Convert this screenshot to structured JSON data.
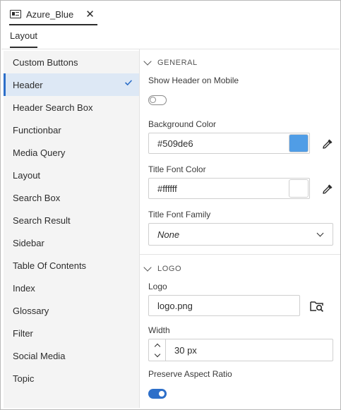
{
  "tab": {
    "title": "Azure_Blue",
    "close_glyph": "✕",
    "icon": "layout-panel-icon"
  },
  "subtab": {
    "label": "Layout"
  },
  "sidebar": {
    "items": [
      {
        "label": "Custom Buttons",
        "selected": false
      },
      {
        "label": "Header",
        "selected": true
      },
      {
        "label": "Header Search Box",
        "selected": false
      },
      {
        "label": "Functionbar",
        "selected": false
      },
      {
        "label": "Media Query",
        "selected": false
      },
      {
        "label": "Layout",
        "selected": false
      },
      {
        "label": "Search Box",
        "selected": false
      },
      {
        "label": "Search Result",
        "selected": false
      },
      {
        "label": "Sidebar",
        "selected": false
      },
      {
        "label": "Table Of Contents",
        "selected": false
      },
      {
        "label": "Index",
        "selected": false
      },
      {
        "label": "Glossary",
        "selected": false
      },
      {
        "label": "Filter",
        "selected": false
      },
      {
        "label": "Social Media",
        "selected": false
      },
      {
        "label": "Topic",
        "selected": false
      }
    ]
  },
  "general": {
    "title": "GENERAL",
    "show_header_mobile": {
      "label": "Show Header on Mobile",
      "on": false
    },
    "background_color": {
      "label": "Background Color",
      "value": "#509de6",
      "swatch": "#509de6"
    },
    "title_font_color": {
      "label": "Title Font Color",
      "value": "#ffffff",
      "swatch": "#ffffff"
    },
    "title_font_family": {
      "label": "Title Font Family",
      "value": "None"
    }
  },
  "logo": {
    "title": "LOGO",
    "logo_field": {
      "label": "Logo",
      "value": "logo.png"
    },
    "width": {
      "label": "Width",
      "value": "30 px"
    },
    "preserve_aspect": {
      "label": "Preserve Aspect Ratio",
      "on": true
    }
  },
  "colors": {
    "accent": "#2d6fc9",
    "selected_bg": "#dde8f5",
    "sidebar_bg": "#f4f4f4"
  }
}
